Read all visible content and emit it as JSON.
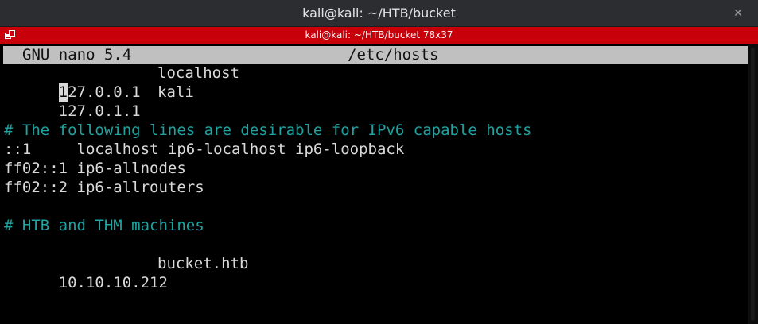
{
  "window": {
    "title": "kali@kali: ~/HTB/bucket",
    "close_glyph": "✕"
  },
  "tab": {
    "title": "kali@kali: ~/HTB/bucket 78x37",
    "icon": "terminal-tab-icon"
  },
  "nano": {
    "version": "GNU nano 5.4",
    "filename": "/etc/hosts"
  },
  "file_lines": [
    {
      "addr": "127.0.0.1",
      "host": "localhost",
      "cursor_char": "1",
      "rest": "27.0.0.1"
    },
    {
      "addr": "127.0.1.1",
      "host": "kali"
    },
    {
      "text": ""
    },
    {
      "text": "# The following lines are desirable for IPv6 capable hosts",
      "comment": true
    },
    {
      "text": "::1     localhost ip6-localhost ip6-loopback"
    },
    {
      "text": "ff02::1 ip6-allnodes"
    },
    {
      "text": "ff02::2 ip6-allrouters"
    },
    {
      "text": ""
    },
    {
      "text": "# HTB and THM machines",
      "comment": true
    },
    {
      "text": ""
    },
    {
      "addr": "10.10.10.212",
      "host": "bucket.htb"
    }
  ],
  "colors": {
    "titlebar": "#2b2d31",
    "tabbar": "#c8000a",
    "terminal_bg": "#000000",
    "text": "#d9d9d9",
    "comment": "#1da3a0",
    "header_bg": "#c0c0c0"
  }
}
